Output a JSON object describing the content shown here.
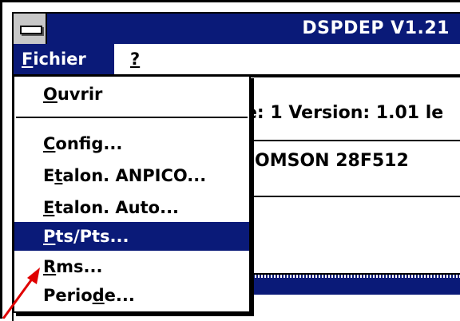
{
  "window": {
    "title": "DSPDEP V1.21"
  },
  "menubar": {
    "file": {
      "label": "Fichier",
      "accel": "F",
      "rest": "ichier"
    },
    "help": {
      "label": "?"
    }
  },
  "content": {
    "info_line": "e: 1 Version:  1.01 le",
    "device_line": "OMSON 28F512"
  },
  "dropdown": {
    "items": [
      {
        "pre": "",
        "accel": "O",
        "post": "uvrir"
      },
      {
        "pre": "",
        "accel": "C",
        "post": "onfig..."
      },
      {
        "pre": "E",
        "accel": "t",
        "post": "alon. ANPICO..."
      },
      {
        "pre": "",
        "accel": "E",
        "post": "talon. Auto..."
      },
      {
        "pre": "",
        "accel": "P",
        "post": "ts/Pts..."
      },
      {
        "pre": "",
        "accel": "R",
        "post": "ms..."
      },
      {
        "pre": "Perio",
        "accel": "d",
        "post": "e..."
      }
    ],
    "selected_index": 4
  },
  "colors": {
    "selection": "#0a1a78",
    "annotation_arrow": "#e00000"
  }
}
